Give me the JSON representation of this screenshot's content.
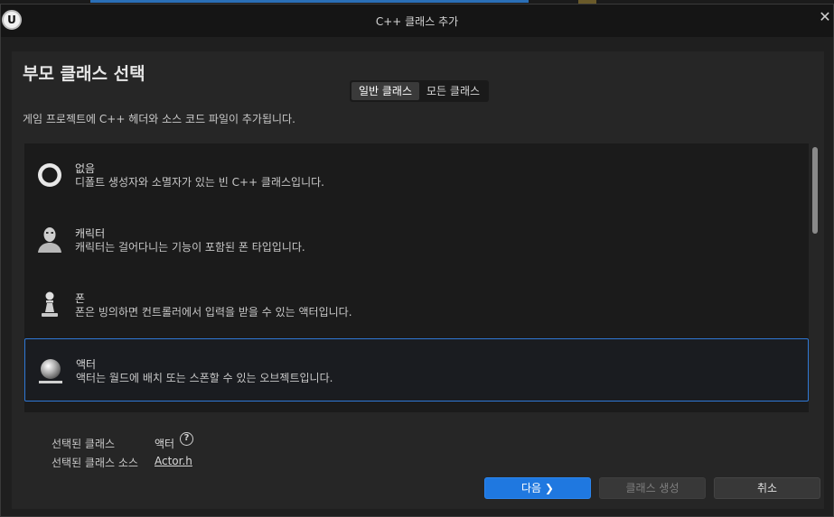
{
  "window": {
    "title": "C++ 클래스 추가",
    "logo_glyph": "U"
  },
  "header": {
    "heading": "부모 클래스 선택",
    "tabs": [
      {
        "label": "일반 클래스",
        "active": true
      },
      {
        "label": "모든 클래스",
        "active": false
      }
    ],
    "description": "게임 프로젝트에 C++ 헤더와 소스 코드 파일이 추가됩니다."
  },
  "classes": [
    {
      "name": "없음",
      "description": "디폴트 생성자와 소멸자가 있는 빈 C++ 클래스입니다.",
      "icon": "empty-class-icon"
    },
    {
      "name": "캐릭터",
      "description": "캐릭터는 걸어다니는 기능이 포함된 폰 타입입니다.",
      "icon": "character-icon"
    },
    {
      "name": "폰",
      "description": "폰은 빙의하면 컨트롤러에서 입력을 받을 수 있는 액터입니다.",
      "icon": "pawn-icon"
    },
    {
      "name": "액터",
      "description": "액터는 월드에 배치 또는 스폰할 수 있는 오브젝트입니다.",
      "icon": "actor-icon",
      "selected": true
    }
  ],
  "selection": {
    "class_label": "선택된 클래스",
    "class_value": "액터",
    "source_label": "선택된 클래스 소스",
    "source_value": "Actor.h"
  },
  "buttons": {
    "next": "다음",
    "create": "클래스 생성",
    "cancel": "취소"
  },
  "colors": {
    "accent": "#1f78e0",
    "selection_border": "#2f78d6"
  }
}
